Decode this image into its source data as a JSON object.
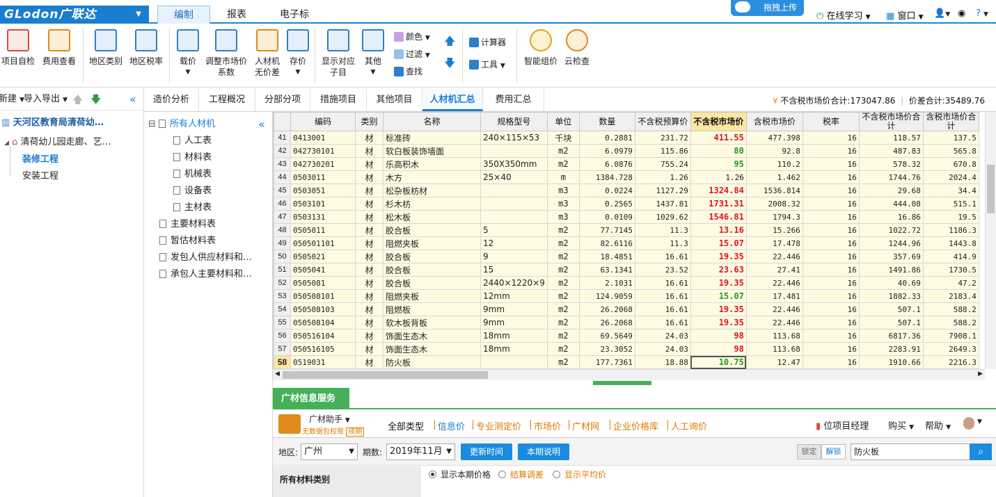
{
  "app": {
    "logo": "GLodon广联达",
    "menu_tabs": [
      "编制",
      "报表",
      "电子标"
    ],
    "upload_label": "拖拽上传",
    "online_label": "在线学习",
    "window_label": "窗口"
  },
  "ribbon": {
    "buttons": [
      {
        "label": "项目自检",
        "icon": "check-doc-icon",
        "color": "#d94b3a"
      },
      {
        "label": "费用查看",
        "icon": "table-search-icon",
        "color": "#e08a1c"
      },
      {
        "label": "地区类别",
        "icon": "region-icon",
        "color": "#2f7fc8"
      },
      {
        "label": "地区税率",
        "icon": "percent-icon",
        "color": "#2f7fc8"
      },
      {
        "label": "载价",
        "icon": "load-price-icon",
        "color": "#2f7fc8"
      },
      {
        "label": "调整市场价\n系数",
        "icon": "adjust-icon",
        "color": "#2f7fc8"
      },
      {
        "label": "人材机\n无价差",
        "icon": "scale-icon",
        "color": "#e08a1c"
      },
      {
        "label": "存价",
        "icon": "save-price-icon",
        "color": "#2f7fc8"
      },
      {
        "label": "显示对应\n子目",
        "icon": "show-items-icon",
        "color": "#2f7fc8"
      },
      {
        "label": "其他",
        "icon": "grid-icon",
        "color": "#2f7fc8"
      },
      {
        "label": "智能组价",
        "icon": "smart-price-icon",
        "color": "#e0a21c"
      },
      {
        "label": "云检查",
        "icon": "cloud-check-icon",
        "color": "#e08a1c"
      }
    ],
    "small": {
      "color": "颜色",
      "filter": "过滤",
      "find": "查找",
      "calculator": "计算器",
      "tools": "工具"
    }
  },
  "left": {
    "new_label": "新建",
    "import_export": "导入导出",
    "project": "天河区教育局清荷幼…",
    "unit": "清荷幼儿园走廊、艺…",
    "decor": "装修工程",
    "install": "安装工程"
  },
  "nav": {
    "root": "所有人材机",
    "items": [
      "人工表",
      "材料表",
      "机械表",
      "设备表",
      "主材表"
    ],
    "other": [
      "主要材料表",
      "暂估材料表",
      "发包人供应材料和…",
      "承包人主要材料和…"
    ]
  },
  "tabs": [
    "造价分析",
    "工程概况",
    "分部分项",
    "措施项目",
    "其他项目",
    "人材机汇总",
    "费用汇总"
  ],
  "active_tab": "人材机汇总",
  "summary": {
    "text": "不含税市场价合计:173047.86",
    "diff": "价差合计:35489.76"
  },
  "grid": {
    "headers": [
      "",
      "编码",
      "类别",
      "名称",
      "规格型号",
      "单位",
      "数量",
      "不含税预算价",
      "不含税市场价",
      "含税市场价",
      "税率",
      "不含税市场价合计",
      "含税市场价合计"
    ],
    "rows": [
      [
        "41",
        "0413001",
        "材",
        "标准砖",
        "240×115×53",
        "千块",
        "0.2881",
        "231.72",
        "411.55",
        "477.398",
        "16",
        "118.57",
        "137.5",
        "red"
      ],
      [
        "42",
        "042730101",
        "材",
        "软白板装饰墙面",
        "",
        "m2",
        "6.0979",
        "115.86",
        "80",
        "92.8",
        "16",
        "487.83",
        "565.8",
        "green"
      ],
      [
        "43",
        "042730201",
        "材",
        "乐高积木",
        "350X350mm",
        "m2",
        "6.0876",
        "755.24",
        "95",
        "110.2",
        "16",
        "578.32",
        "670.8",
        "green"
      ],
      [
        "44",
        "0503011",
        "材",
        "木方",
        "25×40",
        "m",
        "1384.728",
        "1.26",
        "1.26",
        "1.462",
        "16",
        "1744.76",
        "2024.4",
        "plain"
      ],
      [
        "45",
        "0503051",
        "材",
        "松杂板枋材",
        "",
        "m3",
        "0.0224",
        "1127.29",
        "1324.84",
        "1536.814",
        "16",
        "29.68",
        "34.4",
        "red"
      ],
      [
        "46",
        "0503101",
        "材",
        "杉木枋",
        "",
        "m3",
        "0.2565",
        "1437.81",
        "1731.31",
        "2008.32",
        "16",
        "444.08",
        "515.1",
        "red"
      ],
      [
        "47",
        "0503131",
        "材",
        "松木板",
        "",
        "m3",
        "0.0109",
        "1029.62",
        "1546.81",
        "1794.3",
        "16",
        "16.86",
        "19.5",
        "red"
      ],
      [
        "48",
        "0505011",
        "材",
        "胶合板",
        "5",
        "m2",
        "77.7145",
        "11.3",
        "13.16",
        "15.266",
        "16",
        "1022.72",
        "1186.3",
        "red"
      ],
      [
        "49",
        "050501101",
        "材",
        "阻燃夹板",
        "12",
        "m2",
        "82.6116",
        "11.3",
        "15.07",
        "17.478",
        "16",
        "1244.96",
        "1443.8",
        "red"
      ],
      [
        "50",
        "0505021",
        "材",
        "胶合板",
        "9",
        "m2",
        "18.4851",
        "16.61",
        "19.35",
        "22.446",
        "16",
        "357.69",
        "414.9",
        "red"
      ],
      [
        "51",
        "0505041",
        "材",
        "胶合板",
        "15",
        "m2",
        "63.1341",
        "23.52",
        "23.63",
        "27.41",
        "16",
        "1491.86",
        "1730.5",
        "red"
      ],
      [
        "52",
        "0505081",
        "材",
        "胶合板",
        "2440×1220×9",
        "m2",
        "2.1031",
        "16.61",
        "19.35",
        "22.446",
        "16",
        "40.69",
        "47.2",
        "red"
      ],
      [
        "53",
        "050508101",
        "材",
        "阻燃夹板",
        "12mm",
        "m2",
        "124.9059",
        "16.61",
        "15.07",
        "17.481",
        "16",
        "1882.33",
        "2183.4",
        "green"
      ],
      [
        "54",
        "050508103",
        "材",
        "阻燃板",
        "9mm",
        "m2",
        "26.2068",
        "16.61",
        "19.35",
        "22.446",
        "16",
        "507.1",
        "588.2",
        "red"
      ],
      [
        "55",
        "050508104",
        "材",
        "软木板背板",
        "9mm",
        "m2",
        "26.2068",
        "16.61",
        "19.35",
        "22.446",
        "16",
        "507.1",
        "588.2",
        "red"
      ],
      [
        "56",
        "050516104",
        "材",
        "饰面生态木",
        "18mm",
        "m2",
        "69.5649",
        "24.03",
        "98",
        "113.68",
        "16",
        "6817.36",
        "7908.1",
        "red"
      ],
      [
        "57",
        "050516105",
        "材",
        "饰面生态木",
        "18mm",
        "m2",
        "23.3052",
        "24.03",
        "98",
        "113.68",
        "16",
        "2283.91",
        "2649.3",
        "red"
      ],
      [
        "58",
        "0519031",
        "材",
        "防火板",
        "",
        "m2",
        "177.7361",
        "18.88",
        "10.75",
        "12.47",
        "16",
        "1910.66",
        "2216.3",
        "green"
      ]
    ]
  },
  "colors": {
    "red": "#e0141e",
    "green": "#1f9a1f",
    "accent": "#1a7ed0",
    "gc_green": "#44b05a"
  },
  "gc": {
    "title": "广材信息服务",
    "helper": "广材助手",
    "helper_sub": "无数据包权限",
    "helper_badge": "续期",
    "links": [
      "全部类型",
      "信息价",
      "专业测定价",
      "市场价",
      "广材网",
      "企业价格库",
      "人工询价"
    ],
    "right": {
      "unit": "位项目经理",
      "buy": "购买",
      "help": "帮助"
    },
    "region_label": "地区:",
    "region": "广州",
    "period_label": "期数:",
    "period": "2019年11月",
    "update_btn": "更新时间",
    "explain_btn": "本期说明",
    "lock": "锁定",
    "unlock": "解锁",
    "search_value": "防火板",
    "category": "所有材料类别",
    "radios": [
      "显示本期价格",
      "结算调差",
      "显示平均价"
    ]
  }
}
